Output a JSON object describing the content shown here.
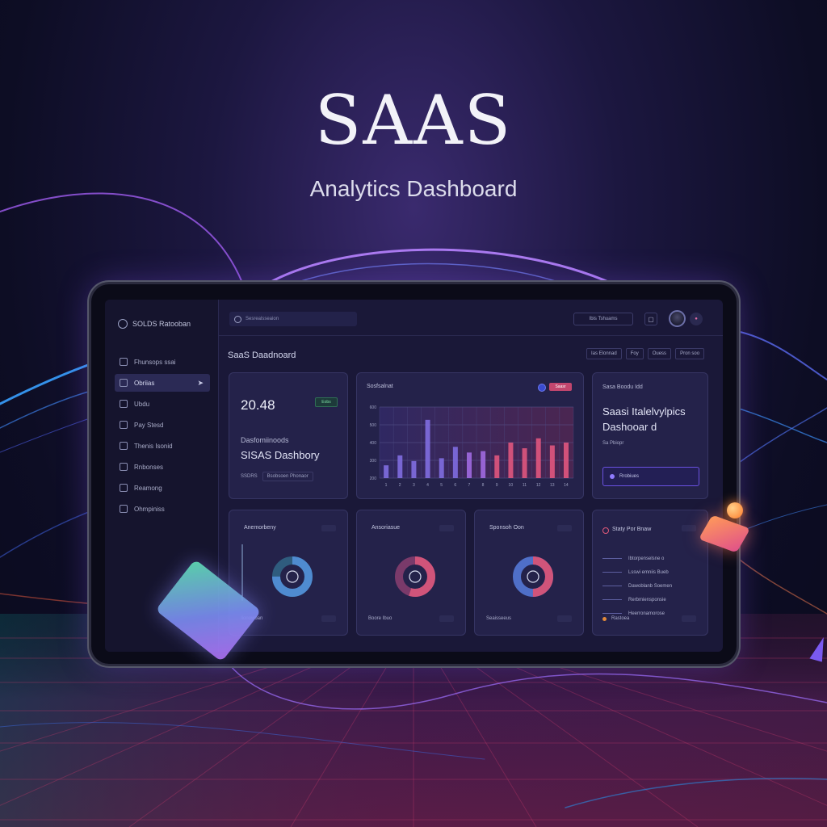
{
  "hero": {
    "title": "SAAS",
    "subtitle": "Analytics Dashboard"
  },
  "sidebar": {
    "brand": "SOLDS Ratooban",
    "items": [
      {
        "label": "Fhunsops ssai",
        "icon": "home-icon"
      },
      {
        "label": "Obriias",
        "icon": "grid-icon",
        "active": true
      },
      {
        "label": "Ubdu",
        "icon": "folder-icon"
      },
      {
        "label": "Pay Stesd",
        "icon": "card-icon"
      },
      {
        "label": "Thenis Isonid",
        "icon": "clock-icon"
      },
      {
        "label": "Rnbonses",
        "icon": "document-icon"
      },
      {
        "label": "Reamong",
        "icon": "layers-icon"
      },
      {
        "label": "Ohmpiniss",
        "icon": "settings-icon"
      }
    ]
  },
  "topbar": {
    "search_placeholder": "Sesrealsseaion",
    "date_range": "Ibis Tshuams",
    "bell_icon": "bell-icon",
    "avatar_icon": "avatar-icon",
    "menu_icon": "menu-icon"
  },
  "page": {
    "title": "SaaS Daadnoard",
    "filters": [
      "Ias Elonnad",
      "Foy",
      "Ouess",
      "Pron soo"
    ]
  },
  "kpi_card": {
    "value": "20.48",
    "badge": "Eobs",
    "label": "Dasfomiinoods",
    "big": "SISAS Dashbory",
    "foot_left": "SSDRS",
    "foot_box": "Bsobsoen Phonaor"
  },
  "chart_card": {
    "title": "Sosfsalnat",
    "tag": "Saasr",
    "y_ticks": [
      "600",
      "500",
      "400",
      "300",
      "200"
    ]
  },
  "chart_data": {
    "type": "bar",
    "categories": [
      "1",
      "2",
      "3",
      "4",
      "5",
      "6",
      "7",
      "8",
      "9",
      "10",
      "11",
      "12",
      "13",
      "14"
    ],
    "series": [
      {
        "values": [
          190,
          260,
          220,
          510,
          240,
          320,
          280,
          290,
          260,
          350,
          310,
          380,
          330,
          350
        ]
      }
    ],
    "ylim": [
      100,
      600
    ],
    "colors": [
      "#7f6de0",
      "#a06ae0",
      "#e0567e"
    ],
    "grid": true
  },
  "promo_card": {
    "small": "Sasa Boodu Idd",
    "title": "Saasi Italelvylpics Dashooar d",
    "meta": "Sa Pbiopr",
    "button": "Rrobiues"
  },
  "donuts": [
    {
      "title": "Anemorbeny",
      "foot": "Iionowoan",
      "value": 0.75,
      "color": "#4f8bd0",
      "track": "#2f5c7e"
    },
    {
      "title": "Ansoriasue",
      "foot": "Boore Ibuo",
      "value": 0.55,
      "color": "#d0547a",
      "track": "#7a3a6a"
    },
    {
      "title": "Sponsoh Oon",
      "foot": "Seaisseeus",
      "value": 0.5,
      "color": "#d0547a",
      "track": "#4f6fc8"
    }
  ],
  "activity_card": {
    "title": "Staty Por Bnaw",
    "items": [
      "Ibtorpenselsne o",
      "Lsswi emniis Bueb",
      "Dawoblanb Soemen",
      "Rerbmiensponsie",
      "Heerronamorose"
    ],
    "foot": "Rastoea"
  }
}
